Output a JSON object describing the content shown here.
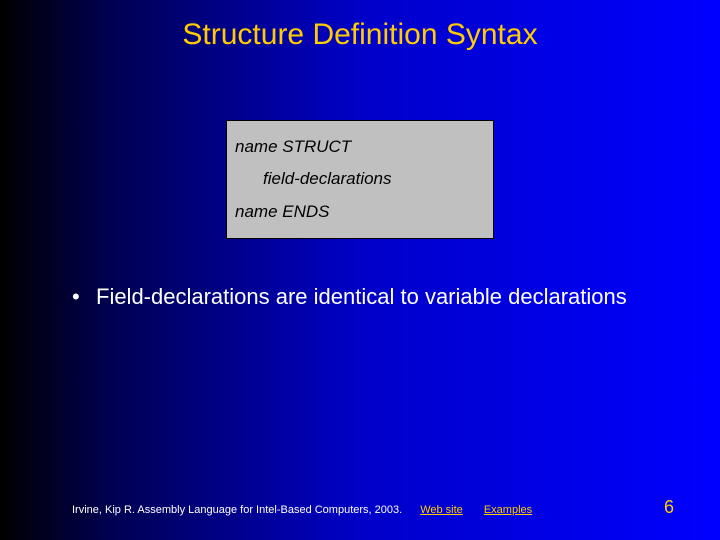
{
  "title": "Structure Definition Syntax",
  "code": {
    "line1": "name STRUCT",
    "line2": "field-declarations",
    "line3": "name ENDS"
  },
  "bullet1": "Field-declarations are identical to variable declarations",
  "footer": {
    "citation": "Irvine, Kip R. Assembly Language for Intel-Based Computers, 2003.",
    "link1": "Web site",
    "link2": "Examples",
    "page": "6"
  }
}
